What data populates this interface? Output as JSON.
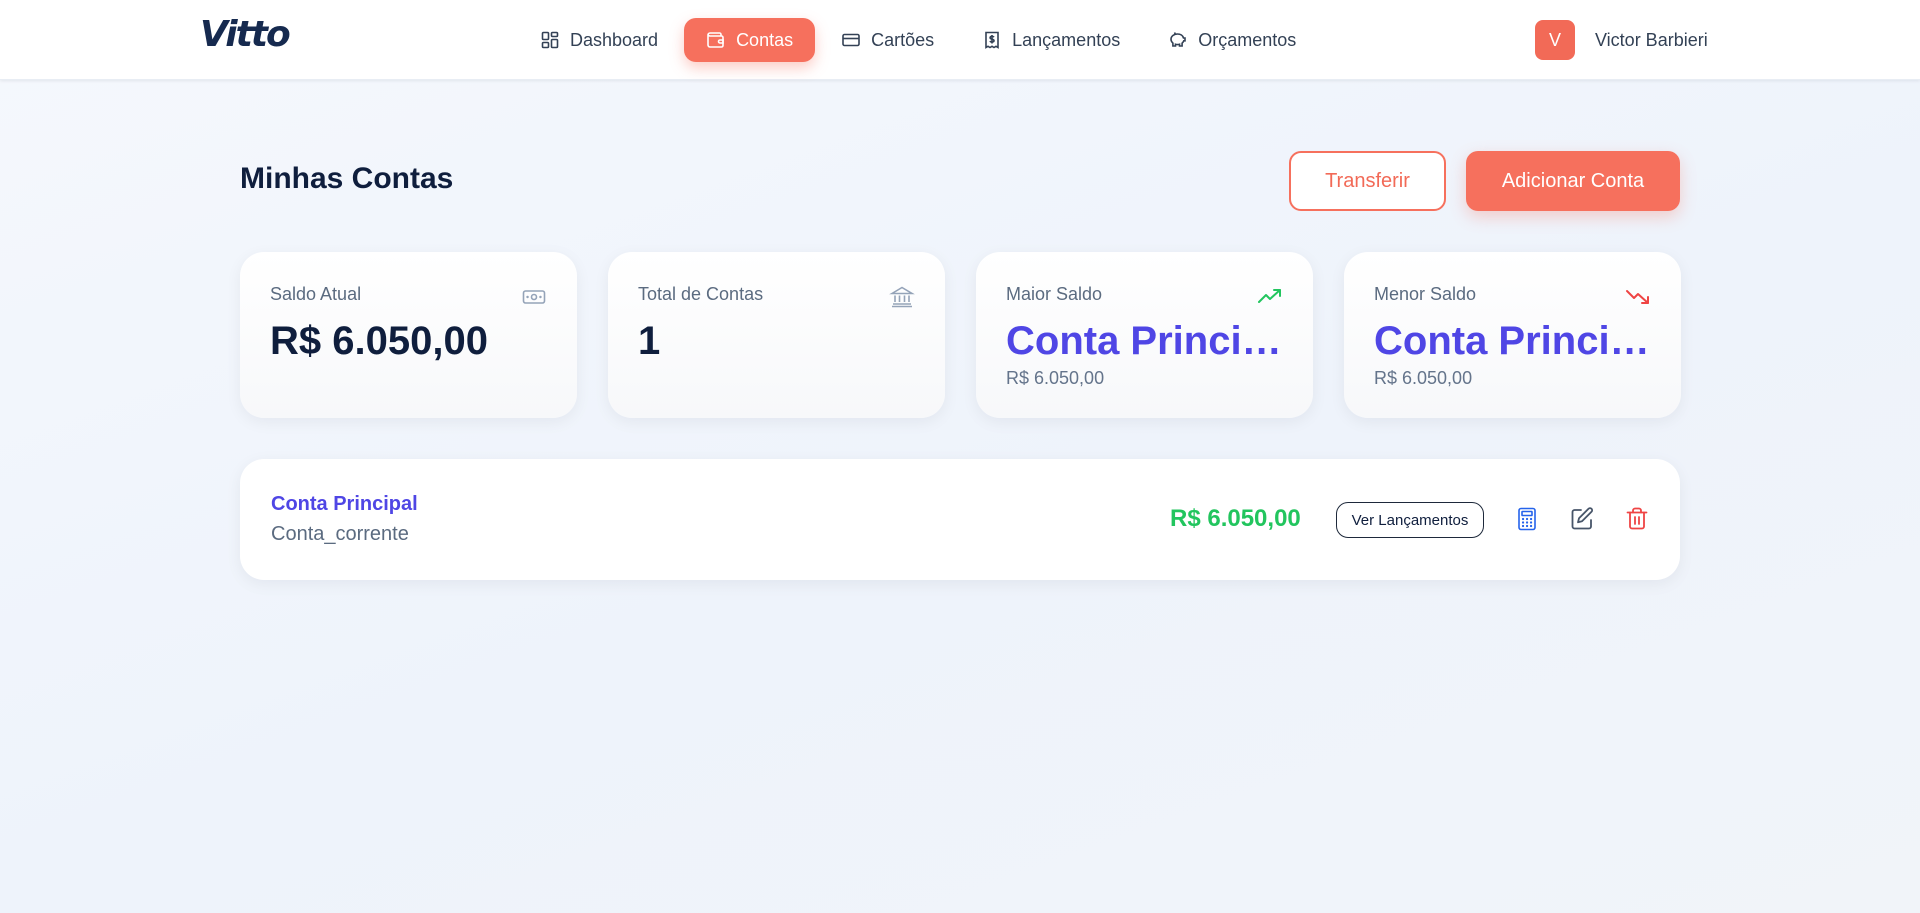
{
  "app": {
    "logo": "Vitto"
  },
  "nav": {
    "items": [
      {
        "label": "Dashboard",
        "icon": "dashboard-grid-icon"
      },
      {
        "label": "Contas",
        "icon": "wallet-icon",
        "active": true
      },
      {
        "label": "Cartões",
        "icon": "credit-card-icon"
      },
      {
        "label": "Lançamentos",
        "icon": "receipt-dollar-icon"
      },
      {
        "label": "Orçamentos",
        "icon": "piggy-bank-icon"
      }
    ]
  },
  "user": {
    "initial": "V",
    "name": "Victor Barbieri"
  },
  "page": {
    "title": "Minhas Contas",
    "transfer_label": "Transferir",
    "add_label": "Adicionar Conta"
  },
  "stats": [
    {
      "label": "Saldo Atual",
      "value": "R$ 6.050,00",
      "sub": "",
      "icon": "banknote-icon"
    },
    {
      "label": "Total de Contas",
      "value": "1",
      "sub": "",
      "icon": "bank-building-icon"
    },
    {
      "label": "Maior Saldo",
      "value": "Conta Principal",
      "sub": "R$ 6.050,00",
      "icon": "trending-up-icon"
    },
    {
      "label": "Menor Saldo",
      "value": "Conta Principal",
      "sub": "R$ 6.050,00",
      "icon": "trending-down-icon"
    }
  ],
  "accounts": [
    {
      "name": "Conta Principal",
      "type": "Conta_corrente",
      "balance": "R$ 6.050,00",
      "view_label": "Ver Lançamentos",
      "actions": [
        "calculator-icon",
        "edit-icon",
        "trash-icon"
      ]
    }
  ],
  "colors": {
    "brand": "#f6705d",
    "accent": "#4f46e5",
    "positive": "#22c55e",
    "negative": "#ef4444",
    "title": "#0f1e3d"
  }
}
